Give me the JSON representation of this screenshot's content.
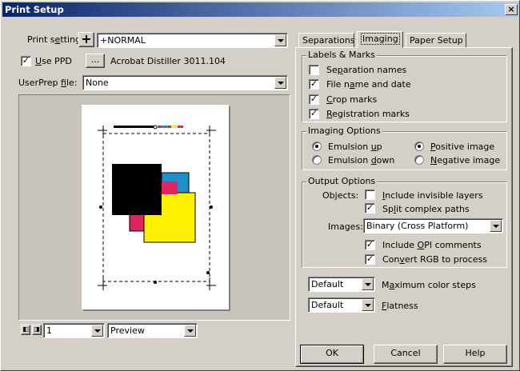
{
  "window": {
    "title": "Print Setup",
    "close": "×"
  },
  "left": {
    "print_setting_label": "Print setting:",
    "print_setting_value": "+NORMAL",
    "plus": "+",
    "use_ppd_label": "Use PPD",
    "use_ppd_checked": "✓",
    "browse": "...",
    "ppd_name": "Acrobat Distiller 3011.104",
    "userprep_label": "UserPrep file:",
    "userprep_value": "None",
    "page_value": "1",
    "view_value": "Preview"
  },
  "tabs": [
    "Separations",
    "Imaging",
    "Paper Setup"
  ],
  "labels_marks": {
    "title": "Labels & Marks",
    "items": [
      {
        "label": "Separation names",
        "checked": ""
      },
      {
        "label": "File name and date",
        "checked": "✓"
      },
      {
        "label": "Crop marks",
        "checked": "✓"
      },
      {
        "label": "Registration marks",
        "checked": "✓"
      }
    ]
  },
  "imaging_options": {
    "title": "Imaging Options",
    "emulsion_up": "Emulsion up",
    "emulsion_down": "Emulsion down",
    "positive": "Positive image",
    "negative": "Negative image"
  },
  "output_options": {
    "title": "Output Options",
    "objects_label": "Objects:",
    "include_invisible": "Include invisible layers",
    "split_paths": "Split complex paths",
    "images_label": "Images:",
    "images_value": "Binary (Cross Platform)",
    "include_opi": "Include OPI comments",
    "convert_rgb": "Convert RGB to process",
    "check": "✓"
  },
  "color_steps": {
    "value": "Default",
    "label": "Maximum color steps"
  },
  "flatness": {
    "value": "Default",
    "label": "Flatness"
  },
  "buttons": {
    "ok": "OK",
    "cancel": "Cancel",
    "help": "Help"
  },
  "colors": {
    "black": "#000000",
    "cyan": "#1e90c8",
    "magenta": "#e0245e",
    "yellow": "#fff000"
  }
}
